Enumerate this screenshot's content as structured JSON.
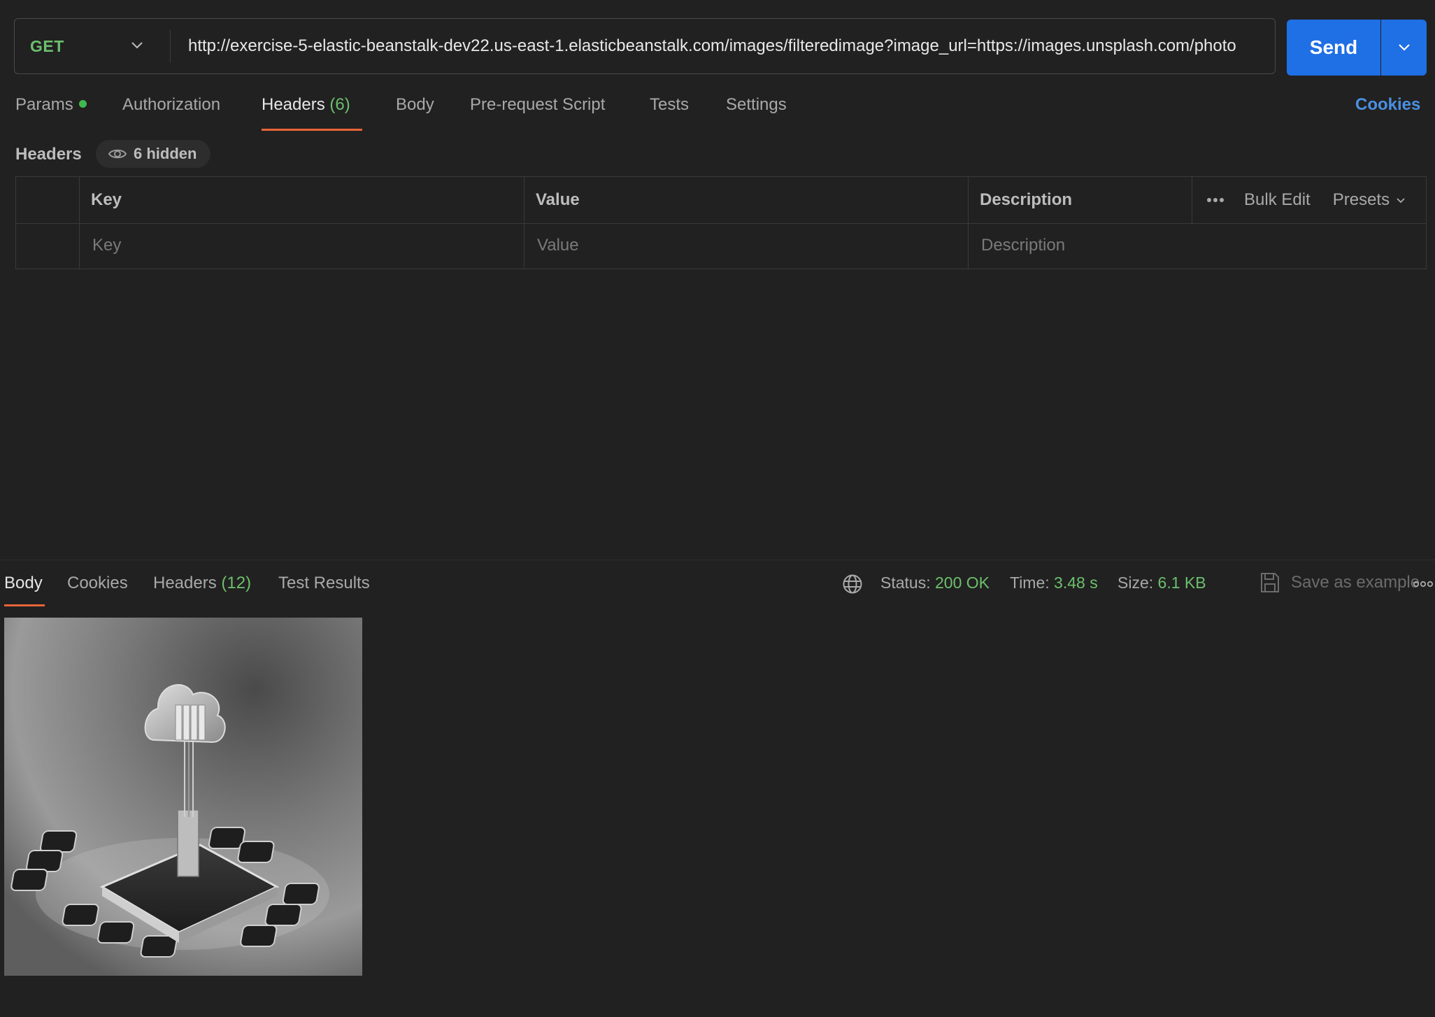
{
  "request": {
    "method": "GET",
    "url": "http://exercise-5-elastic-beanstalk-dev22.us-east-1.elasticbeanstalk.com/images/filteredimage?image_url=https://images.unsplash.com/photo",
    "send_label": "Send"
  },
  "request_tabs": {
    "params": "Params",
    "authorization": "Authorization",
    "headers": "Headers",
    "headers_count": "(6)",
    "body": "Body",
    "prerequest": "Pre-request Script",
    "tests": "Tests",
    "settings": "Settings",
    "cookies": "Cookies"
  },
  "headers_section": {
    "title": "Headers",
    "hidden_label": "6 hidden"
  },
  "table": {
    "columns": {
      "key": "Key",
      "value": "Value",
      "description": "Description"
    },
    "placeholders": {
      "key": "Key",
      "value": "Value",
      "description": "Description"
    },
    "bulk_edit": "Bulk Edit",
    "presets": "Presets"
  },
  "response_tabs": {
    "body": "Body",
    "cookies": "Cookies",
    "headers": "Headers",
    "headers_count": "(12)",
    "test_results": "Test Results"
  },
  "response_status": {
    "status_label": "Status:",
    "status_value": "200 OK",
    "time_label": "Time:",
    "time_value": "3.48 s",
    "size_label": "Size:",
    "size_value": "6.1 KB",
    "save_example": "Save as example"
  },
  "colors": {
    "accent_blue": "#1f6fe5",
    "tab_underline": "#e8643a",
    "success_green": "#6dbf6d"
  }
}
